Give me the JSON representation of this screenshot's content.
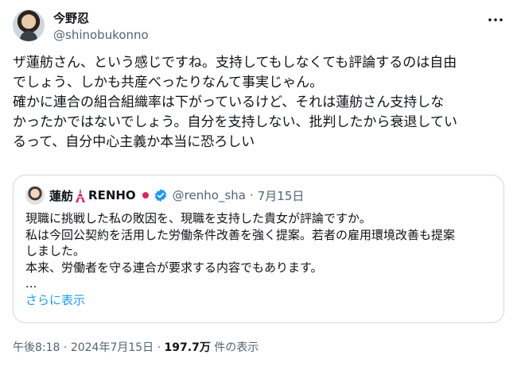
{
  "author": {
    "name": "今野忍",
    "handle": "@shinobukonno"
  },
  "tweet": {
    "lines": [
      "ザ蓮舫さん、という感じですね。支持してもしなくても評論するのは自由",
      "でしょう、しかも共産べったりなんて事実じゃん。",
      "確かに連合の組合組織率は下がっているけど、それは蓮舫さん支持しな",
      "かったかではないでしょう。自分を支持しない、批判したから衰退してい",
      "るって、自分中心主義か本当に恐ろしい"
    ]
  },
  "quote": {
    "name": "蓮舫",
    "name_suffix": "RENHO",
    "handle": "@renho_sha",
    "separator": "·",
    "date": "7月15日",
    "lines": [
      "現職に挑戦した私の敗因を、現職を支持した貴女が評論ですか。",
      "私は今回公契約を活用した労働条件改善を強く提案。若者の雇用環境改善も提案",
      "しました。",
      "本来、労働者を守る連合が要求する内容でもあります。",
      "..."
    ],
    "show_more": "さらに表示"
  },
  "meta": {
    "time": "午後8:18",
    "dot1": "·",
    "date": "2024年7月15日",
    "dot2": "·",
    "views": "197.7万",
    "views_label": "件の表示"
  },
  "colors": {
    "text": "#0f1419",
    "secondary": "#536471",
    "link": "#1d9bf0",
    "border": "#cfd9de",
    "verified": "#1d9bf0"
  },
  "icons": {
    "more": "more-horizontal-icon",
    "tower": "tokyo-tower-icon",
    "verified": "verified-badge-icon"
  }
}
